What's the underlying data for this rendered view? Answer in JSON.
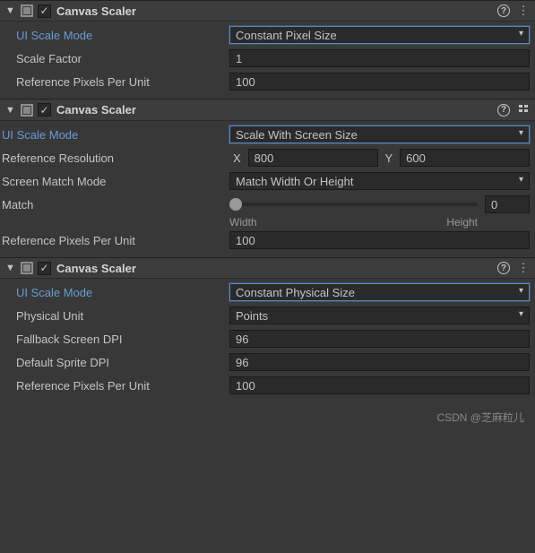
{
  "panels": [
    {
      "title": "Canvas Scaler",
      "scaleMode": {
        "label": "UI Scale Mode",
        "value": "Constant Pixel Size"
      },
      "scaleFactor": {
        "label": "Scale Factor",
        "value": "1"
      },
      "refPixels": {
        "label": "Reference Pixels Per Unit",
        "value": "100"
      }
    },
    {
      "title": "Canvas Scaler",
      "scaleMode": {
        "label": "UI Scale Mode",
        "value": "Scale With Screen Size"
      },
      "refRes": {
        "label": "Reference Resolution",
        "xLabel": "X",
        "x": "800",
        "yLabel": "Y",
        "y": "600"
      },
      "matchMode": {
        "label": "Screen Match Mode",
        "value": "Match Width Or Height"
      },
      "match": {
        "label": "Match",
        "value": "0",
        "minLabel": "Width",
        "maxLabel": "Height"
      },
      "refPixels": {
        "label": "Reference Pixels Per Unit",
        "value": "100"
      }
    },
    {
      "title": "Canvas Scaler",
      "scaleMode": {
        "label": "UI Scale Mode",
        "value": "Constant Physical Size"
      },
      "physUnit": {
        "label": "Physical Unit",
        "value": "Points"
      },
      "fallbackDpi": {
        "label": "Fallback Screen DPI",
        "value": "96"
      },
      "spriteDpi": {
        "label": "Default Sprite DPI",
        "value": "96"
      },
      "refPixels": {
        "label": "Reference Pixels Per Unit",
        "value": "100"
      }
    }
  ],
  "watermark": "CSDN @芝麻粒儿"
}
